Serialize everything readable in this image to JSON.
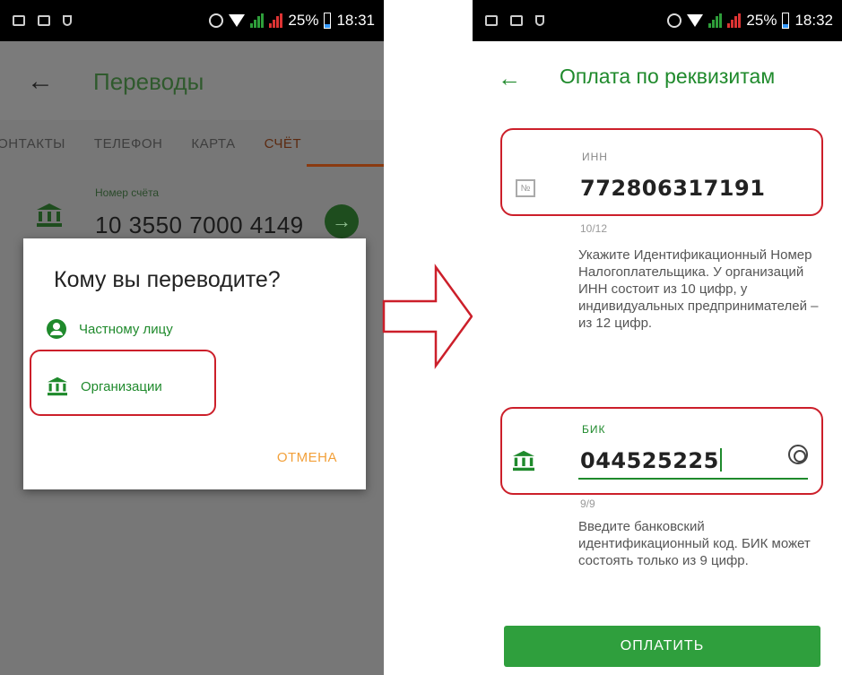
{
  "left_phone": {
    "status": {
      "battery": "25%",
      "time": "18:31"
    },
    "header": {
      "title": "Переводы"
    },
    "tabs": [
      "КОНТАКТЫ",
      "ТЕЛЕФОН",
      "КАРТА",
      "СЧЁТ"
    ],
    "active_tab": "СЧЁТ",
    "account": {
      "label": "Номер счёта",
      "value": "10 3550 7000 4149"
    },
    "dialog": {
      "title": "Кому вы переводите?",
      "option_person": "Частному лицу",
      "option_org": "Организации",
      "cancel": "ОТМЕНА"
    }
  },
  "right_phone": {
    "status": {
      "battery": "25%",
      "time": "18:32"
    },
    "header": {
      "title": "Оплата по реквизитам"
    },
    "inn": {
      "label": "ИНН",
      "icon_text": "№",
      "value": "772806317191",
      "counter": "10/12",
      "hint": "Укажите Идентификационный Номер Налогоплательщика. У организаций ИНН состоит из 10 цифр, у индивидуальных предпринимателей – из 12 цифр."
    },
    "bik": {
      "label": "БИК",
      "value": "044525225",
      "counter": "9/9",
      "hint": "Введите банковский идентификационный код. БИК может состоять только из 9 цифр."
    },
    "pay_button": "ОПЛАТИТЬ"
  },
  "colors": {
    "accent_green": "#1f8a2c",
    "highlight_red": "#cc1f2a",
    "cancel_orange": "#f2a03a"
  }
}
